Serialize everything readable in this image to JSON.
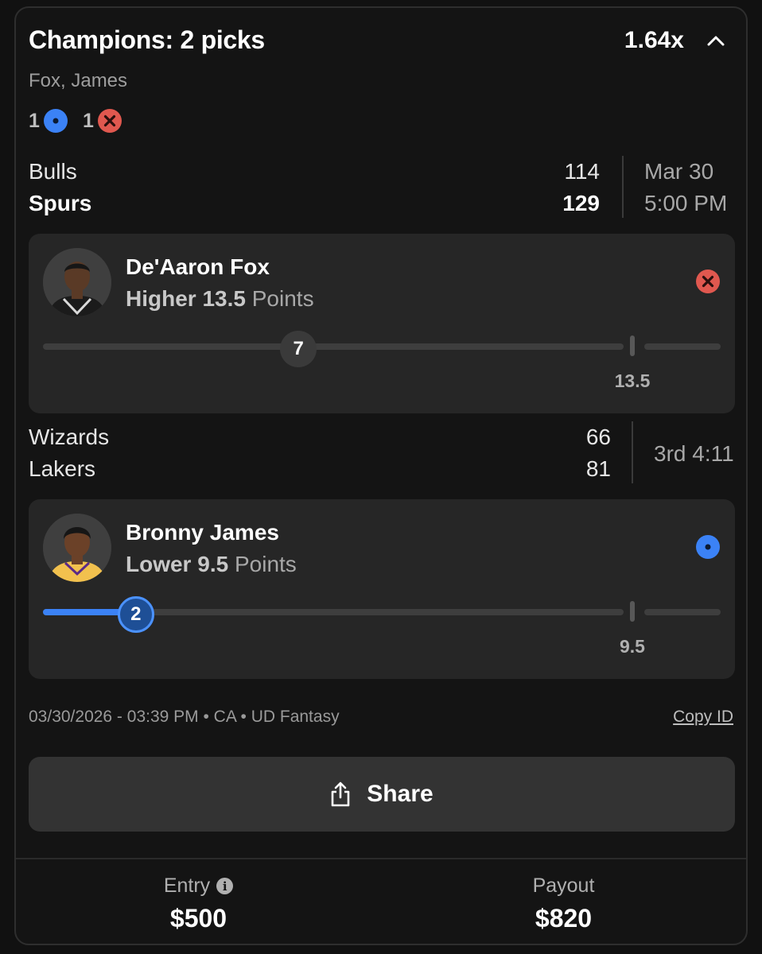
{
  "header": {
    "title": "Champions: 2 picks",
    "multiplier": "1.64x",
    "players": "Fox, James"
  },
  "tally": [
    {
      "count": "1",
      "icon": "active-pick-icon",
      "color": "#3b82f6"
    },
    {
      "count": "1",
      "icon": "lost-pick-icon",
      "color": "#e0584f"
    }
  ],
  "games": [
    {
      "teams": [
        {
          "name": "Bulls",
          "score": "114",
          "bold": false
        },
        {
          "name": "Spurs",
          "score": "129",
          "bold": true
        }
      ],
      "time_line1": "Mar 30",
      "time_line2": "5:00 PM",
      "pick": {
        "player": "De'Aaron Fox",
        "direction": "Higher",
        "line": "13.5",
        "stat": "Points",
        "current": "7",
        "line_label": "13.5",
        "progress": 0.44,
        "status": "lost",
        "status_icon": "x-circle-icon"
      }
    },
    {
      "teams": [
        {
          "name": "Wizards",
          "score": "66",
          "bold": false
        },
        {
          "name": "Lakers",
          "score": "81",
          "bold": false
        }
      ],
      "status_text": "3rd 4:11",
      "pick": {
        "player": "Bronny James",
        "direction": "Lower",
        "line": "9.5",
        "stat": "Points",
        "current": "2",
        "line_label": "9.5",
        "progress": 0.16,
        "status": "live",
        "status_icon": "live-dot-icon"
      }
    }
  ],
  "meta": "03/30/2026 - 03:39 PM • CA • UD Fantasy",
  "copy_id": "Copy ID",
  "share_label": "Share",
  "footer": {
    "entry_label": "Entry",
    "entry_value": "$500",
    "payout_label": "Payout",
    "payout_value": "$820"
  },
  "colors": {
    "accent_blue": "#3b82f6",
    "loss_red": "#e0584f",
    "background": "#141414",
    "card": "#262626"
  }
}
